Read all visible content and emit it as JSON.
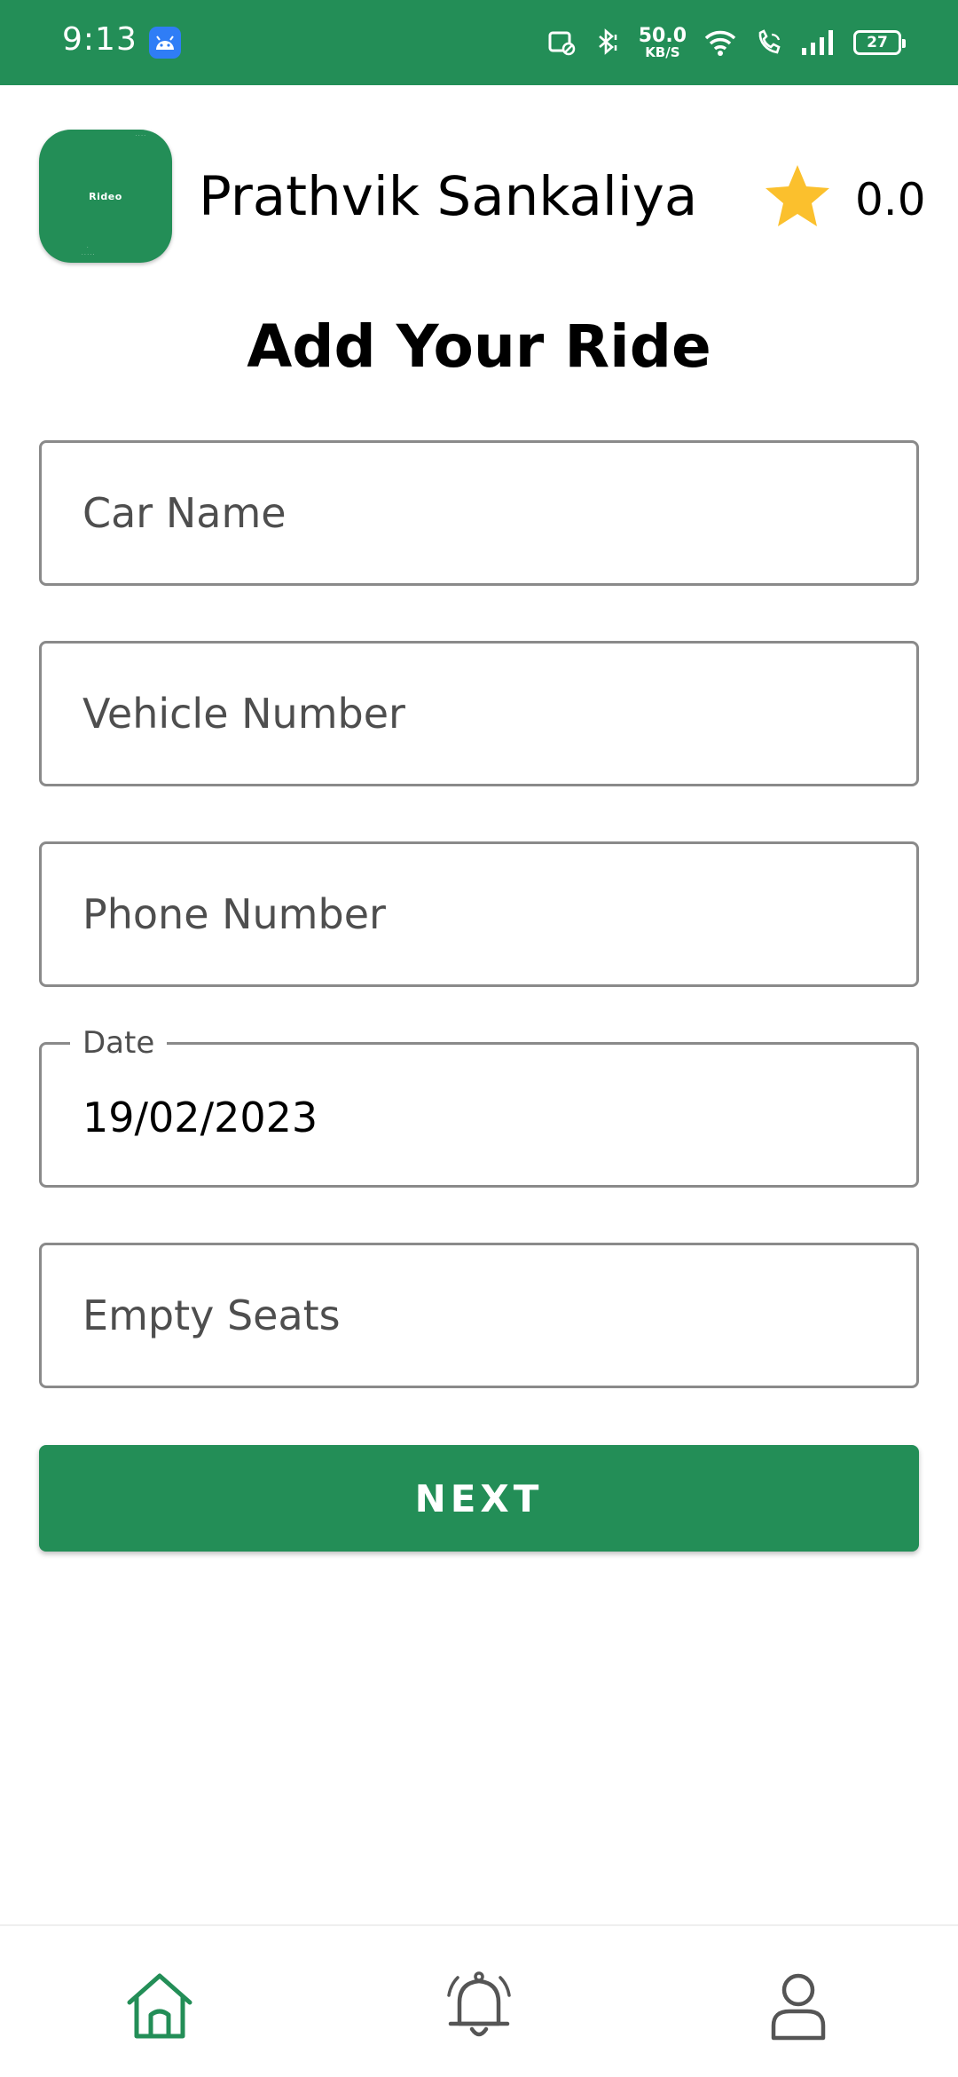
{
  "status_bar": {
    "time": "9:13",
    "net_speed_value": "50.0",
    "net_speed_unit": "KB/S",
    "battery_level": "27",
    "icons": [
      "android-notification-icon",
      "nfc-off-icon",
      "bluetooth-icon",
      "wifi-icon",
      "wifi-call-icon",
      "signal-icon",
      "battery-icon"
    ]
  },
  "header": {
    "user_name": "Prathvik Sankaliya",
    "rating": "0.0",
    "logo_text": "Rideo",
    "icons": [
      "app-logo",
      "star-icon"
    ]
  },
  "page_title": "Add Your Ride",
  "form": {
    "car_name": {
      "placeholder": "Car Name",
      "value": ""
    },
    "vehicle_number": {
      "placeholder": "Vehicle Number",
      "value": ""
    },
    "phone_number": {
      "placeholder": "Phone Number",
      "value": ""
    },
    "date": {
      "label": "Date",
      "value": "19/02/2023"
    },
    "empty_seats": {
      "placeholder": "Empty Seats",
      "value": ""
    }
  },
  "next_button": {
    "label": "NEXT"
  },
  "bottom_nav": {
    "items": [
      {
        "icon": "home-icon",
        "active": true
      },
      {
        "icon": "bell-icon",
        "active": false
      },
      {
        "icon": "user-icon",
        "active": false
      }
    ]
  },
  "colors": {
    "brand": "#238e57",
    "star": "#fbc02d",
    "field_border": "#8a8a8a",
    "nav_inactive": "#555555"
  }
}
